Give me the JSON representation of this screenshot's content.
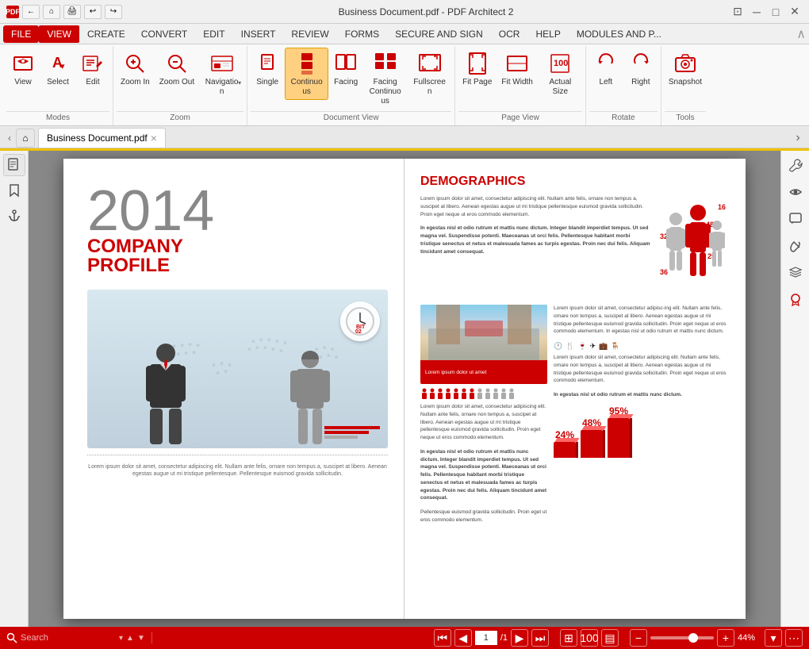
{
  "titlebar": {
    "title": "Business Document.pdf  -  PDF Architect 2",
    "app_icon": "PDF",
    "btn_restore": "⊡",
    "btn_minimize": "─",
    "btn_maximize": "□",
    "btn_close": "✕"
  },
  "menubar": {
    "items": [
      "FILE",
      "VIEW",
      "CREATE",
      "CONVERT",
      "EDIT",
      "INSERT",
      "REVIEW",
      "FORMS",
      "SECURE AND SIGN",
      "OCR",
      "HELP",
      "MODULES AND P..."
    ],
    "active": "VIEW"
  },
  "ribbon": {
    "groups": [
      {
        "label": "Modes",
        "buttons": [
          {
            "id": "view",
            "label": "View",
            "active": false
          },
          {
            "id": "select",
            "label": "Select",
            "active": false
          },
          {
            "id": "edit",
            "label": "Edit",
            "active": false
          }
        ]
      },
      {
        "label": "Zoom",
        "buttons": [
          {
            "id": "zoom-in",
            "label": "Zoom In",
            "active": false
          },
          {
            "id": "zoom-out",
            "label": "Zoom Out",
            "active": false
          },
          {
            "id": "navigation",
            "label": "Navigation",
            "active": false
          }
        ]
      },
      {
        "label": "Document View",
        "buttons": [
          {
            "id": "single",
            "label": "Single",
            "active": false
          },
          {
            "id": "continuous",
            "label": "Continuous",
            "active": true
          },
          {
            "id": "facing",
            "label": "Facing",
            "active": false
          },
          {
            "id": "facing-continuous",
            "label": "Facing Continuous",
            "active": false
          },
          {
            "id": "fullscreen",
            "label": "Fullscreen",
            "active": false
          }
        ]
      },
      {
        "label": "Page View",
        "buttons": [
          {
            "id": "fit-page",
            "label": "Fit Page",
            "active": false
          },
          {
            "id": "fit-width",
            "label": "Fit Width",
            "active": false
          },
          {
            "id": "actual-size",
            "label": "Actual Size",
            "active": false
          }
        ]
      },
      {
        "label": "Rotate",
        "buttons": [
          {
            "id": "left",
            "label": "Left",
            "active": false
          },
          {
            "id": "right",
            "label": "Right",
            "active": false
          }
        ]
      },
      {
        "label": "Tools",
        "buttons": [
          {
            "id": "snapshot",
            "label": "Snapshot",
            "active": false
          }
        ]
      }
    ]
  },
  "tabs": {
    "items": [
      {
        "label": "Business Document.pdf",
        "active": true,
        "closable": true
      }
    ]
  },
  "left_sidebar": {
    "buttons": [
      "☰",
      "🔖",
      "⚓"
    ]
  },
  "right_sidebar": {
    "buttons": [
      "🔧",
      "👁",
      "💬",
      "📎",
      "📚",
      "🔴"
    ]
  },
  "status_bar": {
    "search_placeholder": "Search",
    "page_current": "1",
    "page_total": "/1",
    "zoom_level": "44%"
  },
  "document": {
    "left_page": {
      "year": "2014",
      "title_line1": "COMPANY",
      "title_line2": "PROFILE",
      "footer_text": "Lorem ipsum dolor sit amet, consectetur adipiscing elit. Nullam ante felis, ornare non tempus a, suscipet at libero. Aenean egestas augue ut mi tristique pellentesque. Pellentesque euismod gravida sollicitudin."
    },
    "right_page": {
      "demographics_title": "DEMOGRAPHICS",
      "demo_text": "Lorem ipsum dolor sit amet, consectetur adipiscing elit. Nullam ante felis, ornare non tempus a, suscipet at libero. Aenean egestas augue ut mi tristique pellentesque euismod gravida sollicitudin. Proin eget neque ut eros commodo elementum.",
      "demo_bold_text": "In egestas nisl et odio rutrum et mattis nunc dictum. Integer blandit imperdiet tempus. Ut sed magna vel. Suspendisse potenti. Maeceanas ut orci felis. Pellentesque habitant morbi tristique senectus et netus et malesuada fames ac turpis egestas. Proin nec dui felis. Aliquam tincidunt amet consequat.",
      "hotel_caption": "Lorem ipsum dolor ut amet",
      "right_text": "Lorem ipsum dolor sit amet, consectetur adipisc-ing elit. Nullam ante felis, ornare non tempus a, suscipet at libero. Aenean egestas augue ut mi tristique pellentesque euismod gravida sollicitudin. Proin eget neque ut eros commodo elementum.\n\nIn egestas nisl ut odio rutrum et mattis nunc dictum.",
      "right_text2": "Lorem ipsum dolor sit amet, consectetur adipiscing elit. Nullam ante felis, ornare non tempus a, suscipet at libero. Aenean egestas augue ut mi tristique pellentesque euismod gravida sollicitudin. Proin eget neque ut eros commodo elementum.",
      "right_bold2": "In egestas nisl ut odio rutrum et mattis nunc dictum.",
      "stat1_label": "24%",
      "stat2_label": "48%",
      "stat3_label": "95%"
    }
  }
}
